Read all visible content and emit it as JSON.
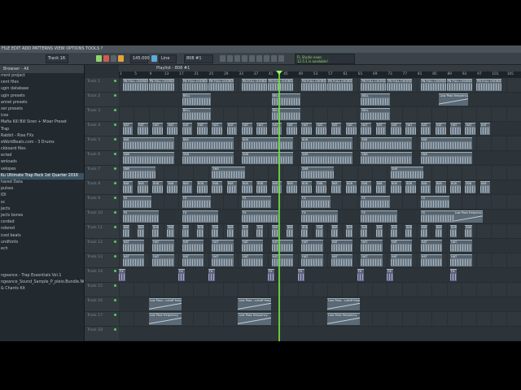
{
  "topstrip": {
    "text": "FILE  EDIT  ADD  PATTERNS  VIEW  OPTIONS  TOOLS  ?"
  },
  "toolbar": {
    "pattern_label": "Track 16",
    "bpm": "145.000",
    "snap": "Line",
    "pattern_select": "808 #1",
    "hint_title": "FL Studio news",
    "hint_text": "12.5.1 is available!"
  },
  "browser": {
    "header": "Browser - All",
    "items": [
      {
        "label": "rrent project",
        "selected": false
      },
      {
        "label": "cent files",
        "selected": false
      },
      {
        "label": "ugin database",
        "selected": false
      },
      {
        "label": "ugin presets",
        "selected": false
      },
      {
        "label": "annel presets",
        "selected": false
      },
      {
        "label": "xer presets",
        "selected": false
      },
      {
        "label": "ices",
        "selected": false
      },
      {
        "label": "Mafia Kill Bill Siren + Mixer Preset",
        "selected": false
      },
      {
        "label": "Trap",
        "selected": false
      },
      {
        "label": "Rabbit - Rise FXs",
        "selected": false
      },
      {
        "label": "eWorkBeats.com - 3 Drums",
        "selected": false
      },
      {
        "label": "ckboard files",
        "selected": false
      },
      {
        "label": "ected",
        "selected": false
      },
      {
        "label": "wnloads",
        "selected": false
      },
      {
        "label": "velopes",
        "selected": false
      },
      {
        "label": "Ku Ultimate Trap Pack 1st Quarter 2016",
        "selected": true
      },
      {
        "label": "hared Data",
        "selected": false
      },
      {
        "label": "pulses",
        "selected": false
      },
      {
        "label": "IDI",
        "selected": false
      },
      {
        "label": "sc",
        "selected": false
      },
      {
        "label": "jects",
        "selected": false
      },
      {
        "label": "jects bones",
        "selected": false
      },
      {
        "label": "corded",
        "selected": false
      },
      {
        "label": "ndered",
        "selected": false
      },
      {
        "label": "iced beats",
        "selected": false
      },
      {
        "label": "undfonts",
        "selected": false
      },
      {
        "label": "ech",
        "selected": false
      },
      {
        "label": "",
        "selected": false
      },
      {
        "label": "",
        "selected": false
      },
      {
        "label": "",
        "selected": false
      },
      {
        "label": "ngeance - Trap Essentials Vol.1",
        "selected": false
      },
      {
        "label": "ngeance_Sound_Sample_P_pleio.Bundle.NGUE0.RnDB",
        "selected": false
      },
      {
        "label": "& Chants Kit",
        "selected": false
      }
    ]
  },
  "playlist": {
    "title": "Playlist - 808 #1",
    "ruler": [
      "1",
      "5",
      "9",
      "13",
      "17",
      "21",
      "25",
      "29",
      "33",
      "37",
      "41",
      "45",
      "49",
      "53",
      "57",
      "61",
      "65",
      "69",
      "73",
      "77",
      "81",
      "85",
      "89",
      "93",
      "97",
      "101",
      "105"
    ],
    "tracks": [
      {
        "name": "Track 1"
      },
      {
        "name": "Track 2"
      },
      {
        "name": "Track 3"
      },
      {
        "name": "Track 4"
      },
      {
        "name": "Track 5"
      },
      {
        "name": "Track 6"
      },
      {
        "name": "Track 7"
      },
      {
        "name": "Track 8"
      },
      {
        "name": "Track 9"
      },
      {
        "name": "Track 10"
      },
      {
        "name": "Track 11"
      },
      {
        "name": "Track 12"
      },
      {
        "name": "Track 13"
      },
      {
        "name": "Track 14"
      },
      {
        "name": "Track 15"
      },
      {
        "name": "Track 16"
      },
      {
        "name": "Track 17"
      },
      {
        "name": "Track 18"
      }
    ],
    "clip_labels": {
      "chords": "PN FULL CHORDS",
      "bell": "BELL",
      "hat": "HAT",
      "snare": "SNR",
      "kick": "808",
      "fx": "FX",
      "lpf": "Low Pass...cutoff frequency",
      "lpf_short": "Low Pass frequency"
    },
    "playhead_bar": 33
  }
}
